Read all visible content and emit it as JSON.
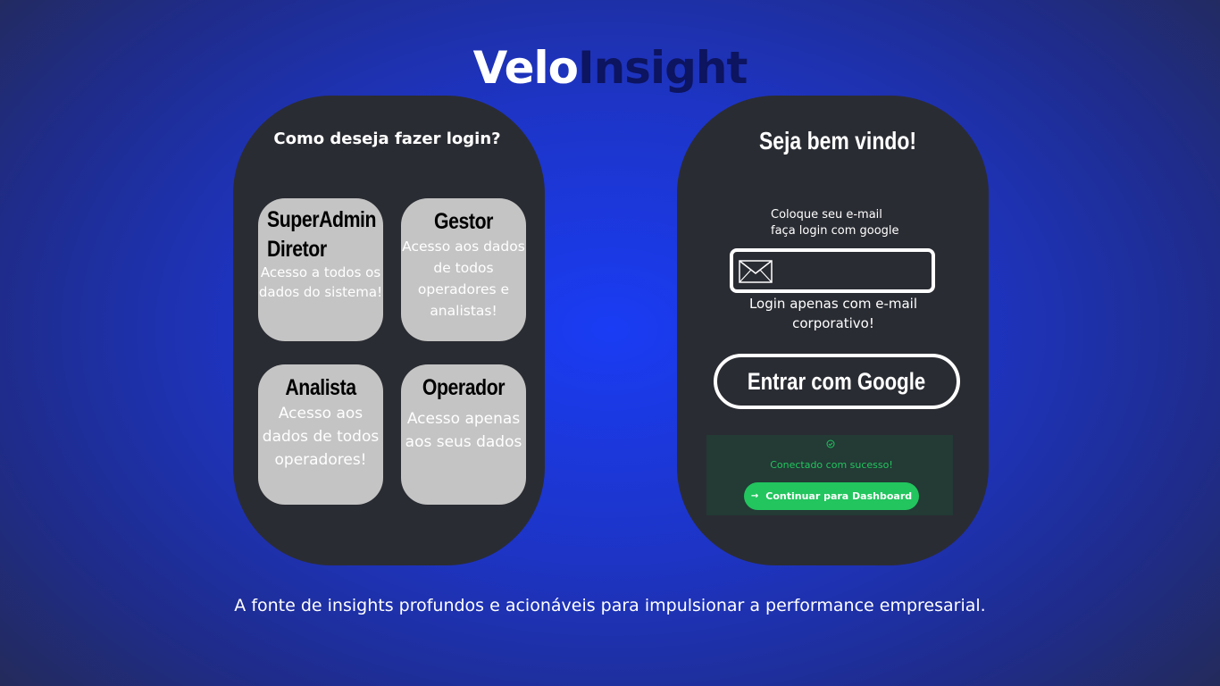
{
  "brand": {
    "part1": "Velo",
    "part2": "Insight",
    "colors": {
      "part1": "#ffffff",
      "part2": "#0d1460"
    }
  },
  "login_type_panel": {
    "title": "Como deseja fazer login?",
    "cards": [
      {
        "title_lines": [
          "SuperAdmin",
          "Diretor"
        ],
        "description": "Acesso a todos os dados do sistema!"
      },
      {
        "title_lines": [
          "Gestor"
        ],
        "description": "Acesso aos dados de todos operadores e analistas!"
      },
      {
        "title_lines": [
          "Analista"
        ],
        "description": "Acesso aos dados de todos operadores!"
      },
      {
        "title_lines": [
          "Operador"
        ],
        "description": "Acesso apenas aos seus dados"
      }
    ]
  },
  "login_panel": {
    "title": "Seja bem vindo!",
    "instructions": [
      "Coloque seu e-mail",
      "faça login com google"
    ],
    "email_field": {
      "value": "",
      "placeholder": "",
      "icon": "mail-icon"
    },
    "note": "Login apenas com e-mail corporativo!",
    "google_button_label": "Entrar com Google",
    "success": {
      "icon": "check-circle-icon",
      "message": "Conectado com sucesso!",
      "button_icon": "arrow-right-icon",
      "button_label": "Continuar para Dashboard",
      "color": "#22c55e"
    }
  },
  "tagline": "A fonte de insights profundos e acionáveis para impulsionar a performance empresarial."
}
